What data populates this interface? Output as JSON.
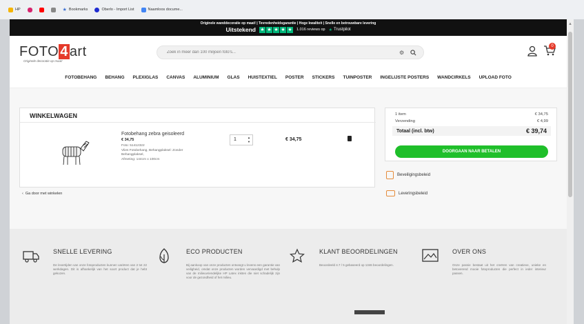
{
  "browser": {
    "bookmarks": [
      {
        "label": "HP",
        "color": "#f5b400"
      },
      {
        "label": "",
        "color": "#d6246e"
      },
      {
        "label": "",
        "color": "#ff0000"
      },
      {
        "label": "",
        "color": "#888888"
      },
      {
        "label": "Bookmarks",
        "color": "#3b6fd1"
      },
      {
        "label": "Oberlo - Import List",
        "color": "#1f2bd1"
      },
      {
        "label": "Naamloos docume...",
        "color": "#4285f4"
      }
    ]
  },
  "promo": {
    "line1": "Originele wanddecoratie op maat! | Tevredenheidsgarantie | Hoge kwaliteit | Snelle en betrouwbare levering",
    "rating_word": "Uitstekend",
    "reviews": "1.016 reviews op",
    "trustpilot": "Trustpilot",
    "star_color": "#00b67a"
  },
  "header": {
    "logo_pre": "FOTO",
    "logo_four": "4",
    "logo_post": "art",
    "logo_tagline": "Originele decoratie op maat!",
    "search_placeholder": "Zoek in meer dan 100 miljoen foto's...",
    "cart_count": "0"
  },
  "nav": [
    "FOTOBEHANG",
    "BEHANG",
    "PLEXIGLAS",
    "CANVAS",
    "ALUMINIUM",
    "GLAS",
    "HUISTEXTIEL",
    "POSTER",
    "STICKERS",
    "TUINPOSTER",
    "INGELIJSTE POSTERS",
    "WANDCIRKELS",
    "UPLOAD FOTO"
  ],
  "cart": {
    "title": "WINKELWAGEN",
    "item": {
      "name": "Fotobehang zebra geisoleerd",
      "price": "€ 34,75",
      "details": [
        "Foto: 51412322",
        "Vlies Fotobehang, Behangplaksel: Zonder",
        "Behangplaksel,",
        "Afmeting: 144cm x 100cm"
      ],
      "quantity": "1",
      "line_total": "€ 34,75"
    },
    "continue_label": "Ga door met winkelen"
  },
  "summary": {
    "items_label": "1 item",
    "items_value": "€ 34,75",
    "shipping_label": "Verzending",
    "shipping_value": "€ 4,99",
    "total_label": "Totaal (incl. btw)",
    "total_value": "€ 39,74",
    "pay_button": "DOORGAAN NAAR BETALEN",
    "accent": "#1fbf2a"
  },
  "policies": [
    "Beveiligingsbeleid",
    "Leveringsbeleid"
  ],
  "features": [
    {
      "title": "SNELLE LEVERING",
      "icon": "truck-icon",
      "text": "De levertijden van onze fotoproducten kunnen variëren van 2 tot 22 werkdagen. Dit is afhankelijk van het soort product dat je hebt gekozen."
    },
    {
      "title": "ECO PRODUCTEN",
      "icon": "eco-leaf-icon",
      "text": "Bij aankoop van onze producten ontvangt u levens een garantie van veiligheid, omdat onze producten worden vervaardigd met behulp van de milieuvriendelijke HP Latex inkten die niet schadelijk zijn voor de gezondheid of het milieu."
    },
    {
      "title": "KLANT BEOORDELINGEN",
      "icon": "star-icon",
      "text": "Beoordeeld 4.7 / 5 gebaseerd op 1346 beoordelingen."
    },
    {
      "title": "OVER ONS",
      "icon": "image-icon",
      "text": "Onze passie bestaat uit het creëren van creatieve, unieke en betoverend mooie fotoproducten die perfect in ieder interieur passen."
    }
  ]
}
